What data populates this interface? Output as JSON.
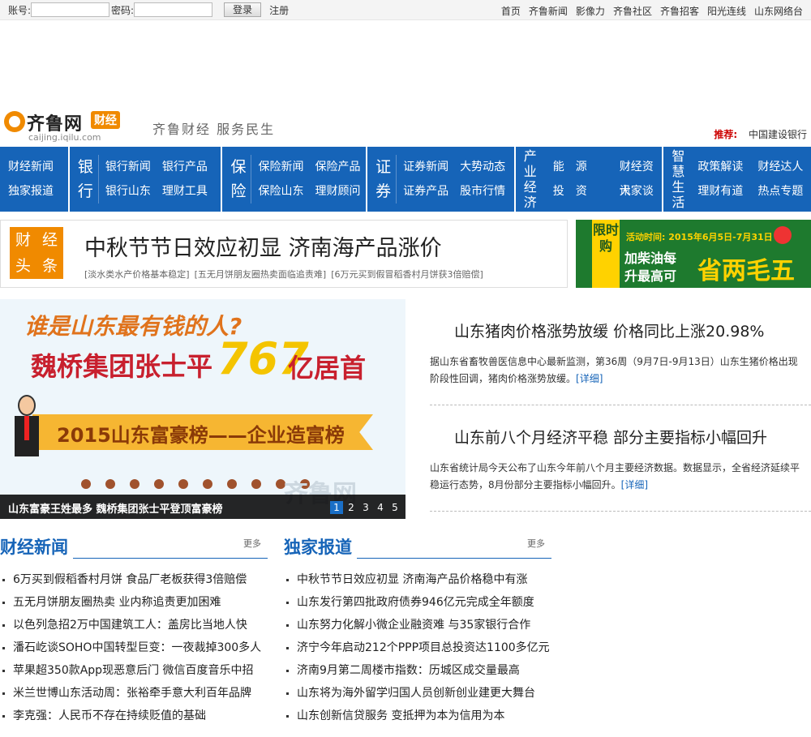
{
  "topbar": {
    "account_label": "账号:",
    "password_label": "密码:",
    "login_button": "登录",
    "register_link": "注册",
    "links": [
      "首页",
      "齐鲁新闻",
      "影像力",
      "齐鲁社区",
      "齐鲁招客",
      "阳光连线",
      "山东网络台"
    ]
  },
  "logo": {
    "name": "齐鲁网",
    "tag": "财经",
    "url": "caijing.iqilu.com",
    "slogan": "齐鲁财经 服务民生"
  },
  "recommend": {
    "label": "推荐:",
    "value": "中国建设银行"
  },
  "nav": {
    "first": [
      "财经新闻",
      "独家报道"
    ],
    "bank": {
      "title_top": "银",
      "title_bottom": "行",
      "items": [
        "银行新闻",
        "银行山东",
        "银行产品",
        "理财工具"
      ]
    },
    "insurance": {
      "title_top": "保",
      "title_bottom": "险",
      "items": [
        "保险新闻",
        "保险山东",
        "保险产品",
        "理财顾问"
      ]
    },
    "securities": {
      "title_top": "证",
      "title_bottom": "券",
      "items": [
        "证券新闻",
        "证券产品",
        "大势动态",
        "股市行情"
      ]
    },
    "industry": {
      "title": "产业经济",
      "items": [
        "能　源",
        "投　资",
        "财经资讯",
        "大家谈"
      ]
    },
    "life": {
      "title": "智慧生活",
      "items": [
        "政策解读",
        "理财有道",
        "财经达人",
        "热点专题"
      ]
    }
  },
  "headline": {
    "tag": [
      "财",
      "经",
      "头",
      "条"
    ],
    "title": "中秋节节日效应初显 济南海产品涨价",
    "subs": [
      "[淡水类水产价格基本稳定]",
      "[五无月饼朋友圈热卖面临追责难]",
      "[6万元买到假冒稻香村月饼获3倍赔偿]"
    ]
  },
  "ad": {
    "tag": "限时购",
    "date": "活动时间: 2015年6月5日-7月31日",
    "line1": "加柴油每",
    "line2": "升最高可",
    "big": "省两毛五"
  },
  "slide": {
    "question": "谁是山东最有钱的人?",
    "main": "魏桥集团张士平",
    "number": "767",
    "suffix": "亿居首",
    "ribbon": "2015山东富豪榜——企业造富榜",
    "watermark": "齐鲁网",
    "caption": "山东富豪王姓最多 魏桥集团张士平登顶富豪榜",
    "pages": [
      "1",
      "2",
      "3",
      "4",
      "5"
    ]
  },
  "stories": [
    {
      "title": "山东猪肉价格涨势放缓 价格同比上涨20.98%",
      "desc": "据山东省畜牧兽医信息中心最新监测，第36周（9月7日-9月13日）山东生猪价格出现阶段性回调，猪肉价格涨势放缓。",
      "more": "[详细]"
    },
    {
      "title": "山东前八个月经济平稳 部分主要指标小幅回升",
      "desc": "山东省统计局今天公布了山东今年前八个月主要经济数据。数据显示，全省经济延续平稳运行态势，8月份部分主要指标小幅回升。",
      "more": "[详细]"
    }
  ],
  "lists": [
    {
      "heading": "财经新闻",
      "more": "更多",
      "items": [
        "6万买到假稻香村月饼 食品厂老板获得3倍赔偿",
        "五无月饼朋友圈热卖 业内称追责更加困难",
        "以色列急招2万中国建筑工人：盖房比当地人快",
        "潘石屹谈SOHO中国转型巨变：一夜裁掉300多人",
        "苹果超350款App现恶意后门 微信百度音乐中招",
        "米兰世博山东活动周：张裕牵手意大利百年品牌",
        "李克强：人民币不存在持续贬值的基础"
      ]
    },
    {
      "heading": "独家报道",
      "more": "更多",
      "items": [
        "中秋节节日效应初显 济南海产品价格稳中有涨",
        "山东发行第四批政府债券946亿元完成全年额度",
        "山东努力化解小微企业融资难 与35家银行合作",
        "济宁今年启动212个PPP项目总投资达1100多亿元",
        "济南9月第二周楼市指数：历城区成交量最高",
        "山东将为海外留学归国人员创新创业建更大舞台",
        "山东创新信贷服务 变抵押为本为信用为本"
      ]
    }
  ],
  "colors": {
    "nav_blue": "#1664b8",
    "accent_orange": "#f08a00"
  }
}
